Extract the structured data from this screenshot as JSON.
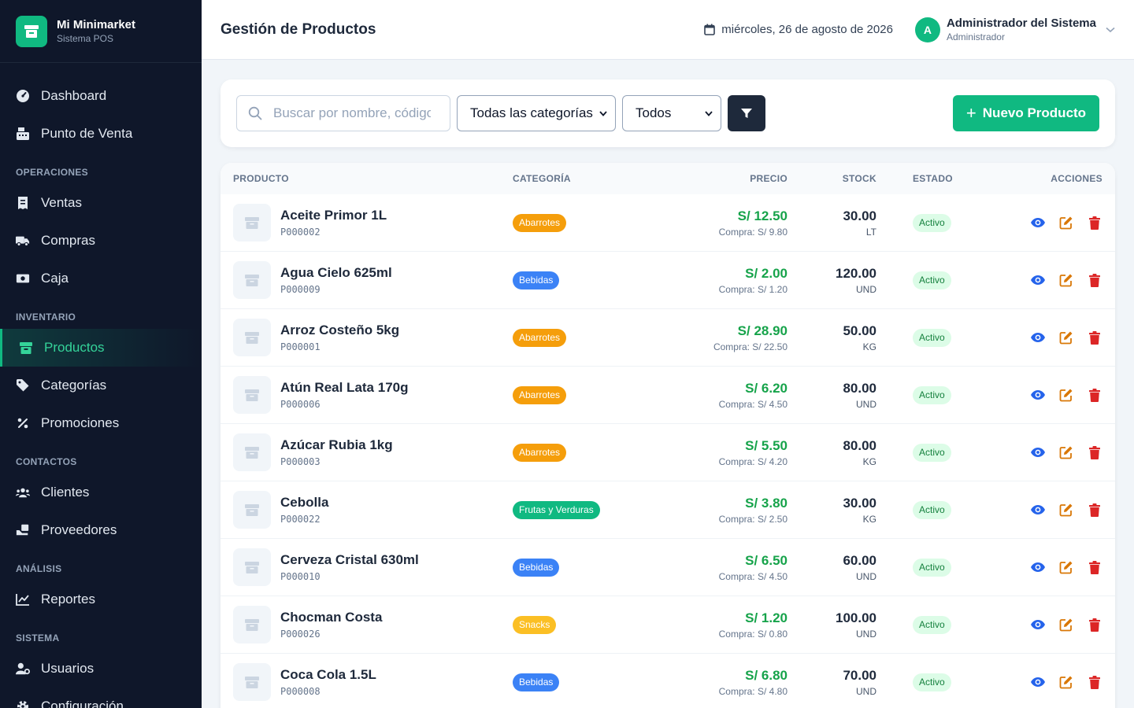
{
  "brand": {
    "name": "Mi Minimarket",
    "subtitle": "Sistema POS"
  },
  "sidebar": {
    "items": [
      {
        "type": "item",
        "name": "dashboard",
        "label": "Dashboard",
        "icon": "gauge-icon"
      },
      {
        "type": "item",
        "name": "punto-de-venta",
        "label": "Punto de Venta",
        "icon": "cash-register-icon"
      },
      {
        "type": "section",
        "label": "OPERACIONES"
      },
      {
        "type": "item",
        "name": "ventas",
        "label": "Ventas",
        "icon": "receipt-icon"
      },
      {
        "type": "item",
        "name": "compras",
        "label": "Compras",
        "icon": "truck-icon"
      },
      {
        "type": "item",
        "name": "caja",
        "label": "Caja",
        "icon": "money-icon"
      },
      {
        "type": "section",
        "label": "INVENTARIO"
      },
      {
        "type": "item",
        "name": "productos",
        "label": "Productos",
        "icon": "box-icon",
        "active": true
      },
      {
        "type": "item",
        "name": "categorias",
        "label": "Categorías",
        "icon": "tags-icon"
      },
      {
        "type": "item",
        "name": "promociones",
        "label": "Promociones",
        "icon": "percent-icon"
      },
      {
        "type": "section",
        "label": "CONTACTOS"
      },
      {
        "type": "item",
        "name": "clientes",
        "label": "Clientes",
        "icon": "users-icon"
      },
      {
        "type": "item",
        "name": "proveedores",
        "label": "Proveedores",
        "icon": "supplier-icon"
      },
      {
        "type": "section",
        "label": "ANÁLISIS"
      },
      {
        "type": "item",
        "name": "reportes",
        "label": "Reportes",
        "icon": "chart-line-icon"
      },
      {
        "type": "section",
        "label": "SISTEMA"
      },
      {
        "type": "item",
        "name": "usuarios",
        "label": "Usuarios",
        "icon": "user-gear-icon"
      },
      {
        "type": "item",
        "name": "configuracion",
        "label": "Configuración",
        "icon": "gear-icon"
      }
    ]
  },
  "header": {
    "title": "Gestión de Productos",
    "date": "miércoles, 26 de agosto de 2026",
    "user_name": "Administrador del Sistema",
    "user_role": "Administrador",
    "avatar_initial": "A"
  },
  "filters": {
    "search_placeholder": "Buscar por nombre, código",
    "category_value": "Todas las categorías",
    "status_value": "Todos",
    "new_button": "Nuevo Producto"
  },
  "table": {
    "headers": {
      "producto": "PRODUCTO",
      "categoria": "CATEGORÍA",
      "precio": "PRECIO",
      "stock": "STOCK",
      "estado": "ESTADO",
      "acciones": "ACCIONES"
    },
    "rows": [
      {
        "name": "Aceite Primor 1L",
        "code": "P000002",
        "category": "Abarrotes",
        "cat_color": "#f59e0b",
        "price": "S/ 12.50",
        "cost": "Compra: S/ 9.80",
        "stock": "30.00",
        "unit": "LT",
        "status": "Activo"
      },
      {
        "name": "Agua Cielo 625ml",
        "code": "P000009",
        "category": "Bebidas",
        "cat_color": "#3b82f6",
        "price": "S/ 2.00",
        "cost": "Compra: S/ 1.20",
        "stock": "120.00",
        "unit": "UND",
        "status": "Activo"
      },
      {
        "name": "Arroz Costeño 5kg",
        "code": "P000001",
        "category": "Abarrotes",
        "cat_color": "#f59e0b",
        "price": "S/ 28.90",
        "cost": "Compra: S/ 22.50",
        "stock": "50.00",
        "unit": "KG",
        "status": "Activo"
      },
      {
        "name": "Atún Real Lata 170g",
        "code": "P000006",
        "category": "Abarrotes",
        "cat_color": "#f59e0b",
        "price": "S/ 6.20",
        "cost": "Compra: S/ 4.50",
        "stock": "80.00",
        "unit": "UND",
        "status": "Activo"
      },
      {
        "name": "Azúcar Rubia 1kg",
        "code": "P000003",
        "category": "Abarrotes",
        "cat_color": "#f59e0b",
        "price": "S/ 5.50",
        "cost": "Compra: S/ 4.20",
        "stock": "80.00",
        "unit": "KG",
        "status": "Activo"
      },
      {
        "name": "Cebolla",
        "code": "P000022",
        "category": "Frutas y Verduras",
        "cat_color": "#10b981",
        "price": "S/ 3.80",
        "cost": "Compra: S/ 2.50",
        "stock": "30.00",
        "unit": "KG",
        "status": "Activo"
      },
      {
        "name": "Cerveza Cristal 630ml",
        "code": "P000010",
        "category": "Bebidas",
        "cat_color": "#3b82f6",
        "price": "S/ 6.50",
        "cost": "Compra: S/ 4.50",
        "stock": "60.00",
        "unit": "UND",
        "status": "Activo"
      },
      {
        "name": "Chocman Costa",
        "code": "P000026",
        "category": "Snacks",
        "cat_color": "#fbbf24",
        "price": "S/ 1.20",
        "cost": "Compra: S/ 0.80",
        "stock": "100.00",
        "unit": "UND",
        "status": "Activo"
      },
      {
        "name": "Coca Cola 1.5L",
        "code": "P000008",
        "category": "Bebidas",
        "cat_color": "#3b82f6",
        "price": "S/ 6.80",
        "cost": "Compra: S/ 4.80",
        "stock": "70.00",
        "unit": "UND",
        "status": "Activo"
      }
    ]
  },
  "colors": {
    "accent": "#10b981",
    "sidebar_bg": "#0f172a",
    "price_green": "#16a34a",
    "view_blue": "#2563eb",
    "edit_amber": "#d97706",
    "delete_red": "#dc2626"
  }
}
